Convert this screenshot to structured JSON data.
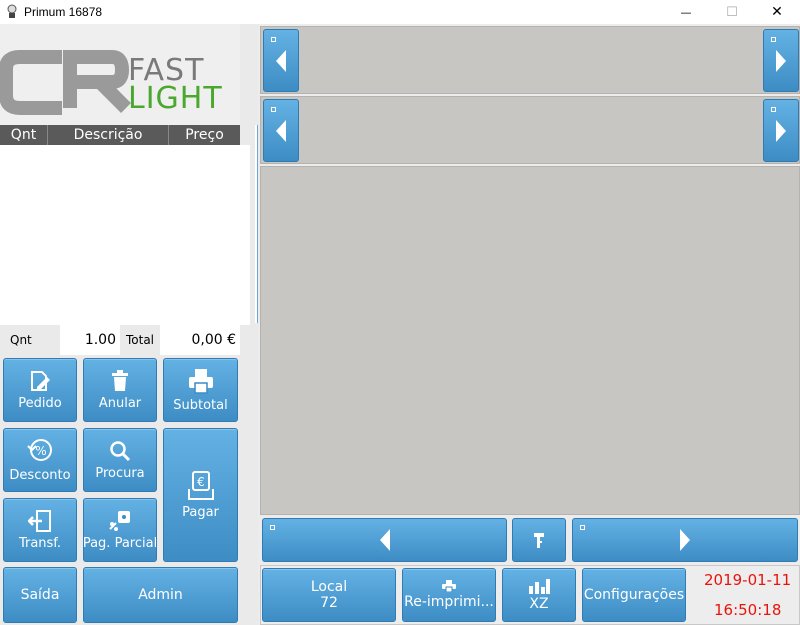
{
  "window": {
    "title": "Primum 16878",
    "minimize": "—",
    "maximize": "☐",
    "close": "✕"
  },
  "logo": {
    "brand_line1": "FAST",
    "brand_line2": "LIGHT"
  },
  "list": {
    "columns": [
      "Qnt",
      "Descrição",
      "Preço"
    ]
  },
  "quantity": {
    "label": "Qnt",
    "value": "1.00",
    "total_label": "Total",
    "total_value": "0,00 €"
  },
  "buttons": {
    "pedido": "Pedido",
    "anular": "Anular",
    "subtotal": "Subtotal",
    "desconto": "Desconto",
    "procura": "Procura",
    "pagar": "Pagar",
    "transf": "Transf.",
    "pag_parcial": "Pag. Parcial",
    "saida": "Saída",
    "admin": "Admin"
  },
  "bottom_bar": {
    "local_label": "Local",
    "local_number": "72",
    "reprint": "Re-imprimi...",
    "xz": "XZ",
    "config": "Configurações",
    "date": "2019-01-11",
    "time": "16:50:18"
  },
  "icons": {
    "pedido": "pencil-icon",
    "anular": "trash-icon",
    "subtotal": "printer-icon",
    "desconto": "discount-icon",
    "procura": "search-icon",
    "pagar": "euro-icon",
    "transf": "transfer-icon",
    "pag_parcial": "partial-payment-icon",
    "reprint": "printer-icon",
    "xz": "bar-chart-icon",
    "tool": "key-icon"
  },
  "colors": {
    "accent": "#4a9fd6",
    "datetime": "#e8140c",
    "panel": "#c8c6c2"
  }
}
